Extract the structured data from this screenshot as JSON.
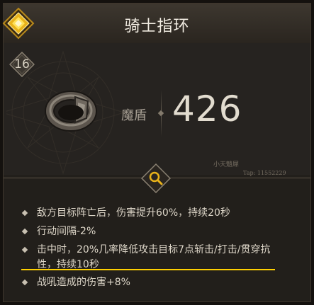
{
  "item": {
    "title": "骑士指环",
    "level": "16",
    "rarity_icon": "rarity-diamond-icon",
    "image_icon": "ring-icon"
  },
  "stat": {
    "label": "魔盾",
    "value": "426"
  },
  "watermark": {
    "name": "小天魈犀",
    "tap_id": "Tap: 11552229"
  },
  "inspect": {
    "icon": "magnifier-icon"
  },
  "effects": [
    {
      "text": "敌方目标阵亡后，伤害提升60%，持续20秒"
    },
    {
      "text": "行动间隔-2%"
    },
    {
      "text": "击中时，20%几率降低攻击目标7点斩击/打击/贯穿抗性，持续10秒"
    },
    {
      "text": "战吼造成的伤害+8%"
    }
  ],
  "colors": {
    "highlight": "#ffd000",
    "rarity_gold": "#e8b21a"
  }
}
